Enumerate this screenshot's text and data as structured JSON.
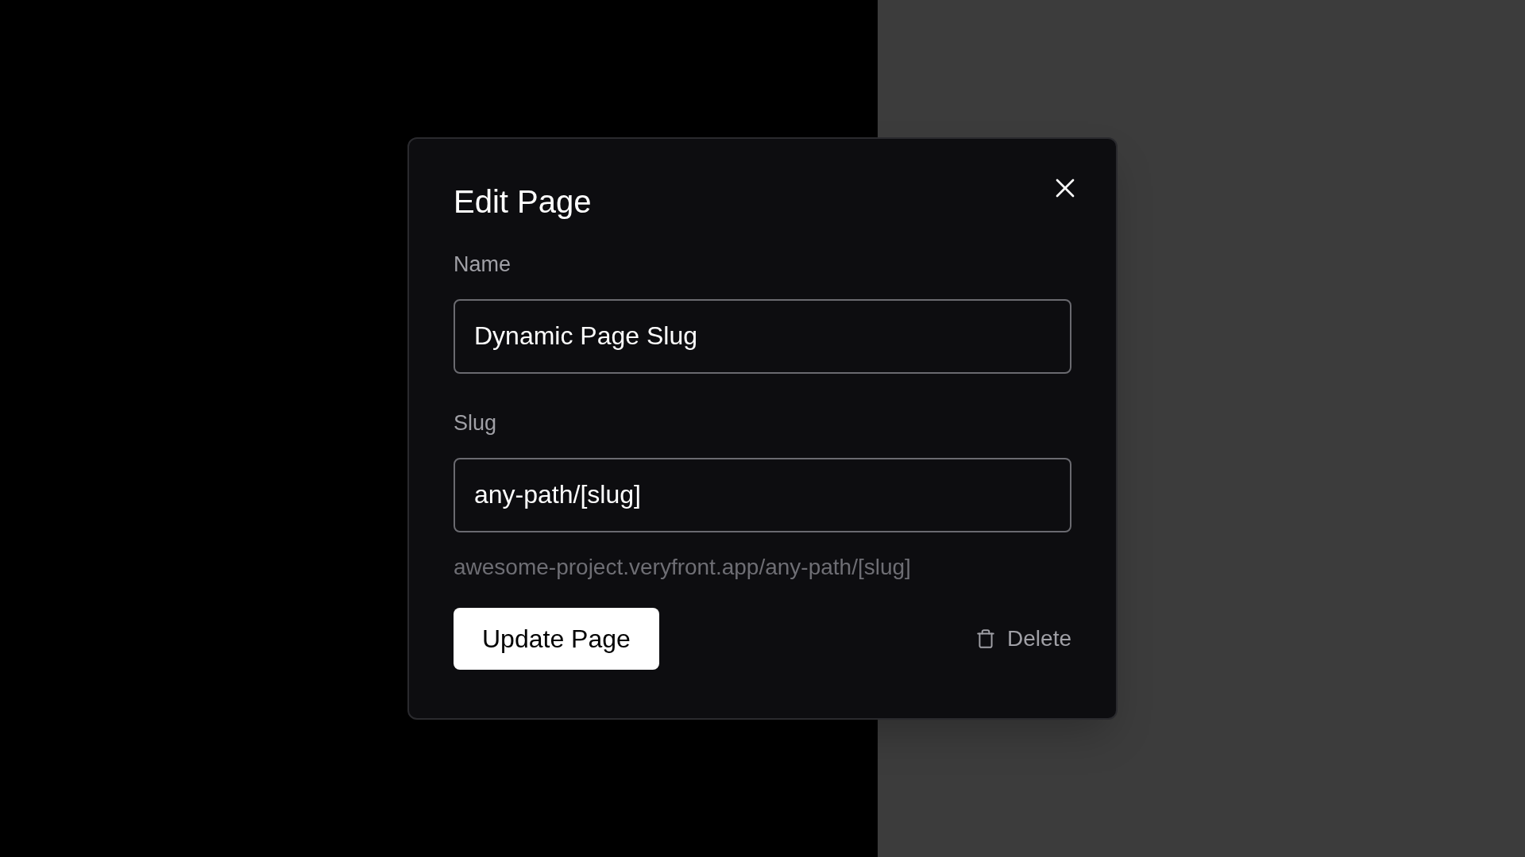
{
  "dialog": {
    "title": "Edit Page",
    "fields": [
      {
        "label": "Name",
        "value": "Dynamic Page Slug"
      },
      {
        "label": "Slug",
        "value": "any-path/[slug]"
      }
    ],
    "url_preview": "awesome-project.veryfront.app/any-path/[slug]",
    "primary_button": "Update Page",
    "delete_button": "Delete"
  }
}
